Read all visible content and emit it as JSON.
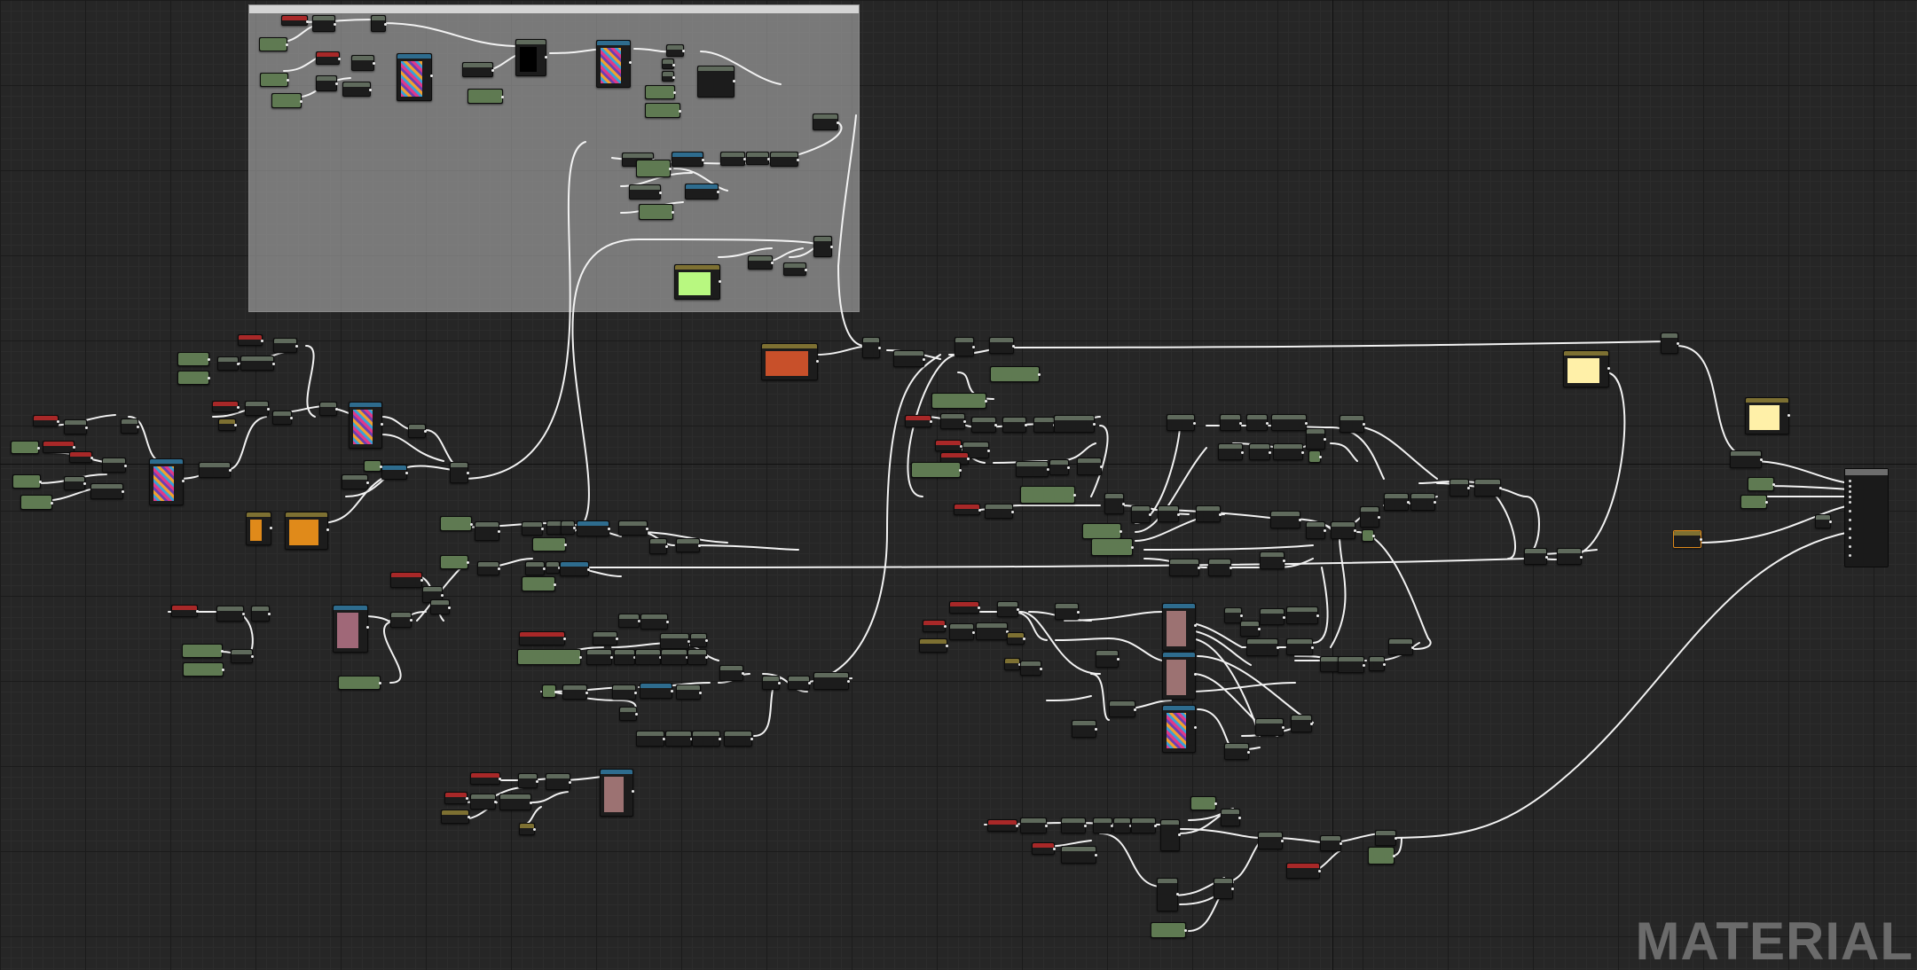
{
  "editor": {
    "watermark": "MATERIAL"
  },
  "colors": {
    "background": "#262626",
    "wire": "#f2f2f2",
    "comment_box": "#bebebe",
    "header_green": "#5f7a52",
    "header_red": "#a82828",
    "header_blue": "#2e6c8e",
    "header_olive": "#7d7032",
    "texture_preview": "#9c7272",
    "param_green": "#b8f880",
    "param_yellow": "#fff0a8",
    "param_orange": "#e08a1a"
  },
  "icons": {
    "pin": "dot",
    "result_pins": "white-dots"
  }
}
